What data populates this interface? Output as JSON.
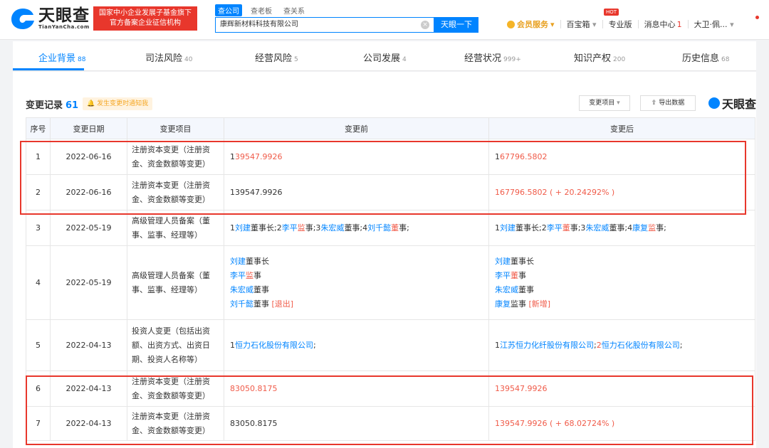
{
  "header": {
    "logo_cn": "天眼查",
    "logo_en": "TianYanCha.com",
    "gov_badge_line1": "国家中小企业发展子基金旗下",
    "gov_badge_line2": "官方备案企业征信机构",
    "search_tabs": [
      "查公司",
      "查老板",
      "查关系"
    ],
    "search_value": "康辉新材料科技有限公司",
    "search_button": "天眼一下",
    "vip_label": "会员服务",
    "baibao": "百宝箱",
    "hot_badge": "HOT",
    "pro": "专业版",
    "messages": "消息中心",
    "messages_count": "1",
    "user": "大卫·佩..."
  },
  "tabs": [
    {
      "label": "企业背景",
      "count": "88"
    },
    {
      "label": "司法风险",
      "count": "40"
    },
    {
      "label": "经营风险",
      "count": "5"
    },
    {
      "label": "公司发展",
      "count": "4"
    },
    {
      "label": "经营状况",
      "count": "999+"
    },
    {
      "label": "知识产权",
      "count": "200"
    },
    {
      "label": "历史信息",
      "count": "68"
    }
  ],
  "section": {
    "title": "变更记录",
    "count": "61",
    "notify": "发生变更时通知我",
    "filter_button": "变更项目",
    "export_button": "导出数据",
    "watermark": "天眼查"
  },
  "table": {
    "columns": [
      "序号",
      "变更日期",
      "变更项目",
      "变更前",
      "变更后"
    ],
    "rows": [
      {
        "no": "1",
        "date": "2022-06-16",
        "item": "注册资本变更（注册资金、资金数额等变更）",
        "before": [
          [
            {
              "t": "1",
              "c": ""
            },
            {
              "t": "39547.9926",
              "c": "red"
            }
          ]
        ],
        "after": [
          [
            {
              "t": "1",
              "c": ""
            },
            {
              "t": "67796.5802",
              "c": "red"
            }
          ]
        ]
      },
      {
        "no": "2",
        "date": "2022-06-16",
        "item": "注册资本变更（注册资金、资金数额等变更）",
        "before": [
          [
            {
              "t": "139547.9926",
              "c": ""
            }
          ]
        ],
        "after": [
          [
            {
              "t": "167796.5802 ( + 20.24292% )",
              "c": "red"
            }
          ]
        ]
      },
      {
        "no": "3",
        "date": "2022-05-19",
        "item": "高级管理人员备案（董事、监事、经理等）",
        "before": [
          [
            {
              "t": "1",
              "c": ""
            },
            {
              "t": "刘建",
              "c": "blue"
            },
            {
              "t": "董事长;2",
              "c": ""
            },
            {
              "t": "李平",
              "c": "blue"
            },
            {
              "t": "监",
              "c": "red"
            },
            {
              "t": "事;3",
              "c": ""
            },
            {
              "t": "朱宏威",
              "c": "blue"
            },
            {
              "t": "董事;4",
              "c": ""
            },
            {
              "t": "刘千懿",
              "c": "blue"
            },
            {
              "t": "董",
              "c": "red"
            },
            {
              "t": "事;",
              "c": ""
            }
          ]
        ],
        "after": [
          [
            {
              "t": "1",
              "c": ""
            },
            {
              "t": "刘建",
              "c": "blue"
            },
            {
              "t": "董事长;2",
              "c": ""
            },
            {
              "t": "李平",
              "c": "blue"
            },
            {
              "t": "董",
              "c": "red"
            },
            {
              "t": "事;3",
              "c": ""
            },
            {
              "t": "朱宏威",
              "c": "blue"
            },
            {
              "t": "董事;4",
              "c": ""
            },
            {
              "t": "康复",
              "c": "blue"
            },
            {
              "t": "监",
              "c": "red"
            },
            {
              "t": "事;",
              "c": ""
            }
          ]
        ]
      },
      {
        "no": "4",
        "date": "2022-05-19",
        "item": "高级管理人员备案（董事、监事、经理等）",
        "before": [
          [
            {
              "t": "刘建",
              "c": "blue"
            },
            {
              "t": "董事长",
              "c": ""
            }
          ],
          [
            {
              "t": "李平",
              "c": "blue"
            },
            {
              "t": "监",
              "c": "red"
            },
            {
              "t": "事",
              "c": ""
            }
          ],
          [
            {
              "t": "朱宏威",
              "c": "blue"
            },
            {
              "t": "董事",
              "c": ""
            }
          ],
          [
            {
              "t": "刘千懿",
              "c": "blue"
            },
            {
              "t": "董事 ",
              "c": ""
            },
            {
              "t": "[退出]",
              "c": "red"
            }
          ]
        ],
        "after": [
          [
            {
              "t": "刘建",
              "c": "blue"
            },
            {
              "t": "董事长",
              "c": ""
            }
          ],
          [
            {
              "t": "李平",
              "c": "blue"
            },
            {
              "t": "董",
              "c": "red"
            },
            {
              "t": "事",
              "c": ""
            }
          ],
          [
            {
              "t": "朱宏威",
              "c": "blue"
            },
            {
              "t": "董事",
              "c": ""
            }
          ],
          [
            {
              "t": "康复",
              "c": "blue"
            },
            {
              "t": "监事 ",
              "c": ""
            },
            {
              "t": "[新增]",
              "c": "red"
            }
          ]
        ]
      },
      {
        "no": "5",
        "date": "2022-04-13",
        "item": "投资人变更（包括出资额、出资方式、出资日期、投资人名称等）",
        "before": [
          [
            {
              "t": "1",
              "c": ""
            },
            {
              "t": "恒力石化股份有限公司",
              "c": "blue"
            },
            {
              "t": ";",
              "c": ""
            }
          ]
        ],
        "after": [
          [
            {
              "t": "1",
              "c": ""
            },
            {
              "t": "江苏恒力化纤股份有限公司",
              "c": "blue"
            },
            {
              "t": ";",
              "c": ""
            },
            {
              "t": "2",
              "c": "red"
            },
            {
              "t": "恒力石化股份有限公司",
              "c": "blue"
            },
            {
              "t": ";",
              "c": ""
            }
          ]
        ]
      },
      {
        "no": "6",
        "date": "2022-04-13",
        "item": "注册资本变更（注册资金、资金数额等变更）",
        "before": [
          [
            {
              "t": "83050.8175",
              "c": "red"
            }
          ]
        ],
        "after": [
          [
            {
              "t": "139547.9926",
              "c": "red"
            }
          ]
        ]
      },
      {
        "no": "7",
        "date": "2022-04-13",
        "item": "注册资本变更（注册资金、资金数额等变更）",
        "before": [
          [
            {
              "t": "83050.8175",
              "c": ""
            }
          ]
        ],
        "after": [
          [
            {
              "t": "139547.9926 ( + 68.02724% )",
              "c": "red"
            }
          ]
        ]
      }
    ]
  },
  "colors": {
    "accent": "#0084ff",
    "diff_red": "#f05b49",
    "highlight": "#e8372c"
  }
}
